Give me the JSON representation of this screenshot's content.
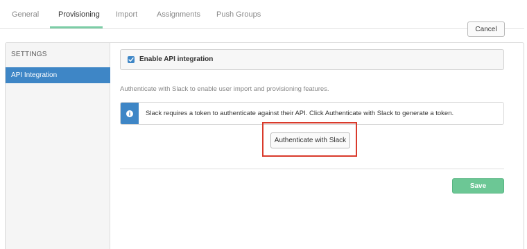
{
  "tabs": [
    {
      "label": "General"
    },
    {
      "label": "Provisioning",
      "active": true
    },
    {
      "label": "Import"
    },
    {
      "label": "Assignments"
    },
    {
      "label": "Push Groups"
    }
  ],
  "sidebar": {
    "heading": "SETTINGS",
    "items": [
      {
        "label": "API Integration",
        "selected": true
      }
    ]
  },
  "form": {
    "cancel_label": "Cancel",
    "enable_checkbox": {
      "label": "Enable API integration",
      "checked": true
    },
    "hint": "Authenticate with Slack to enable user import and provisioning features.",
    "info_message": "Slack requires a token to authenticate against their API. Click Authenticate with Slack to generate a token.",
    "authenticate_label": "Authenticate with Slack",
    "save_label": "Save"
  },
  "colors": {
    "accent_blue": "#3e86c6",
    "tab_underline": "#7ccda6",
    "save_green": "#6cc795",
    "highlight_red": "#d93a2b"
  },
  "icons": [
    "check-icon",
    "info-icon"
  ]
}
